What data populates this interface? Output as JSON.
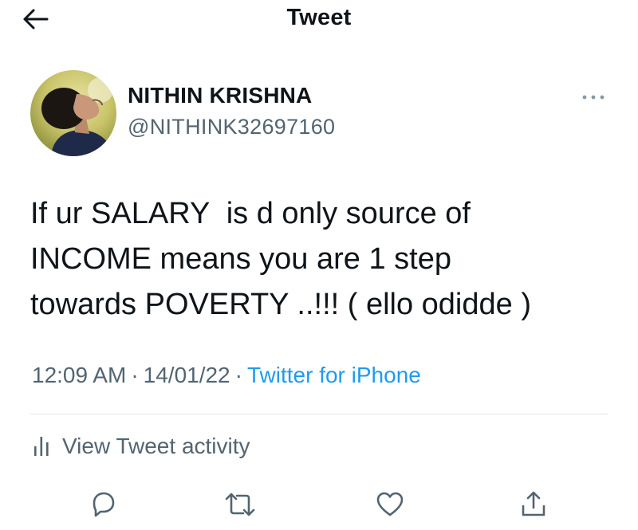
{
  "header": {
    "title": "Tweet",
    "back_icon": "arrow-left-icon"
  },
  "author": {
    "display_name": "NITHIN KRISHNA",
    "handle": "@NITHINK32697160",
    "avatar_icon": "profile-photo"
  },
  "tweet": {
    "text_lines": [
      "If ur SALARY  is d only source of",
      "INCOME means you are 1 step",
      "towards POVERTY ..!!! ( ello odidde )"
    ],
    "time": "12:09 AM",
    "date": "14/01/22",
    "source": "Twitter for iPhone"
  },
  "activity": {
    "label": "View Tweet activity",
    "icon": "bar-chart-icon"
  },
  "actions": [
    {
      "name": "reply",
      "icon": "reply-icon"
    },
    {
      "name": "retweet",
      "icon": "retweet-icon"
    },
    {
      "name": "like",
      "icon": "heart-icon"
    },
    {
      "name": "share",
      "icon": "share-icon"
    }
  ],
  "colors": {
    "text_primary": "#0f1419",
    "text_secondary": "#536471",
    "link": "#1d9bf0",
    "divider": "#dfe3e7"
  }
}
